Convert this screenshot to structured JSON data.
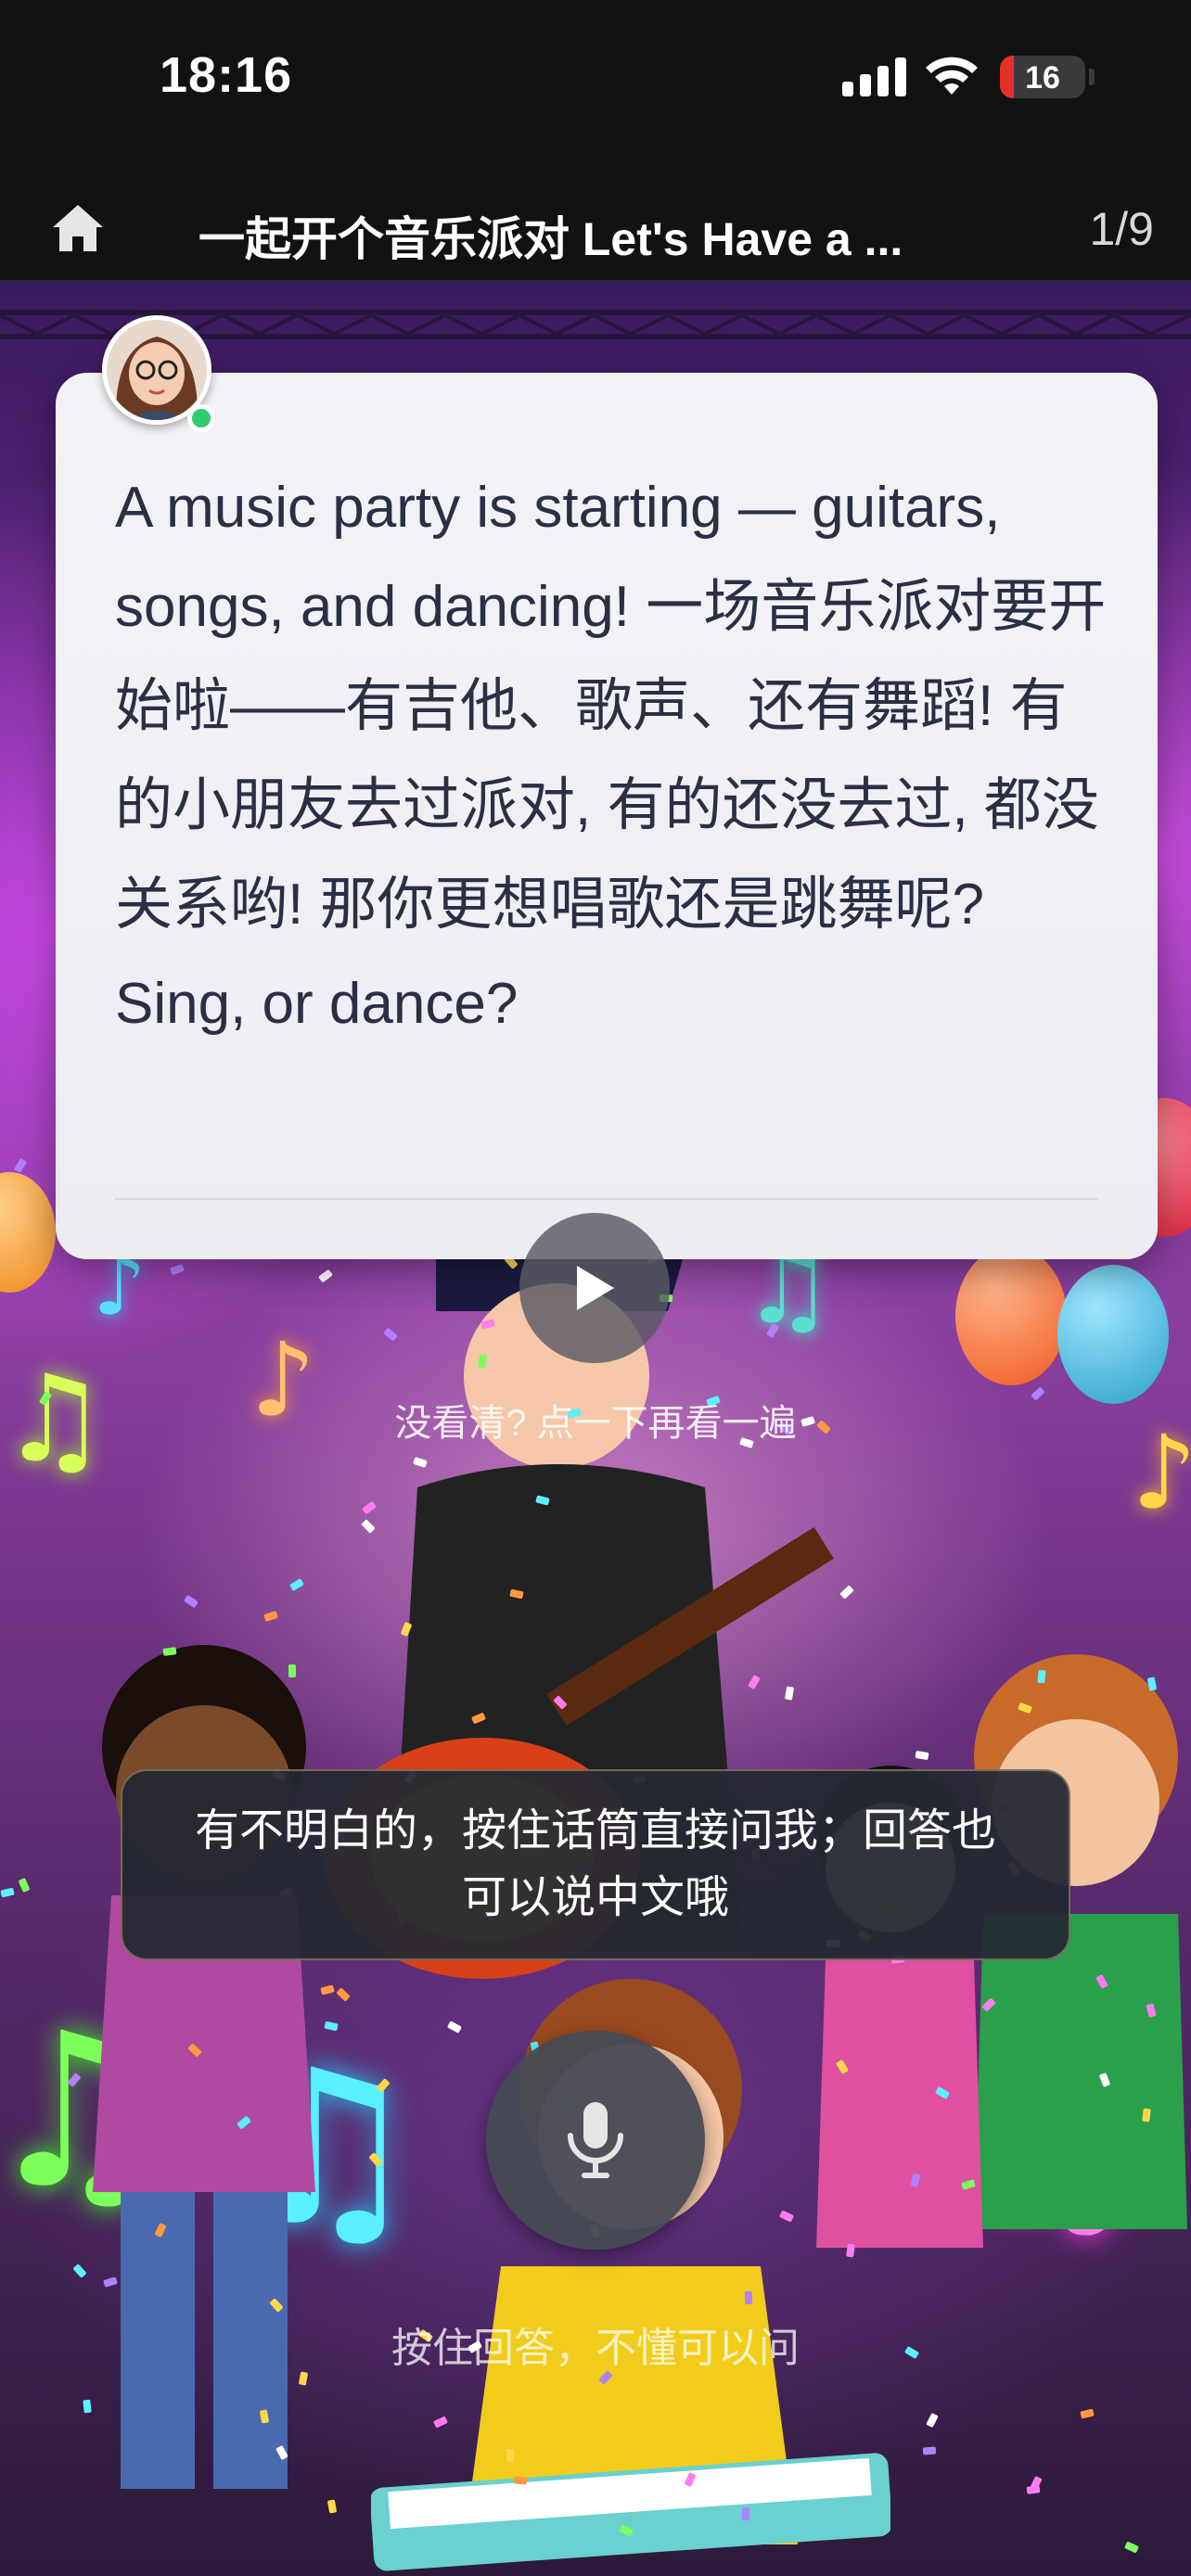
{
  "status_bar": {
    "time": "18:16",
    "battery_level": "16",
    "battery_fraction": 0.16,
    "battery_color": "#e5302a",
    "icons": [
      "signal-icon",
      "wifi-icon",
      "battery-icon"
    ]
  },
  "nav": {
    "home_icon": "home-icon",
    "title": "一起开个音乐派对 Let's Have a ...",
    "page_counter": "1/9"
  },
  "message": {
    "text": "A music party is starting — guitars, songs, and dancing! 一场音乐派对要开始啦——有吉他、歌声、还有舞蹈! 有的小朋友去过派对, 有的还没去过, 都没关系哟! 那你更想唱歌还是跳舞呢? Sing, or dance?",
    "online_color": "#2ecc71"
  },
  "replay": {
    "icon": "play-icon",
    "hint": "没看清? 点一下再看一遍"
  },
  "tip": {
    "text": "有不明白的，按住话筒直接问我；回答也可以说中文哦"
  },
  "mic": {
    "icon": "microphone-icon",
    "hint": "按住回答，不懂可以问"
  }
}
